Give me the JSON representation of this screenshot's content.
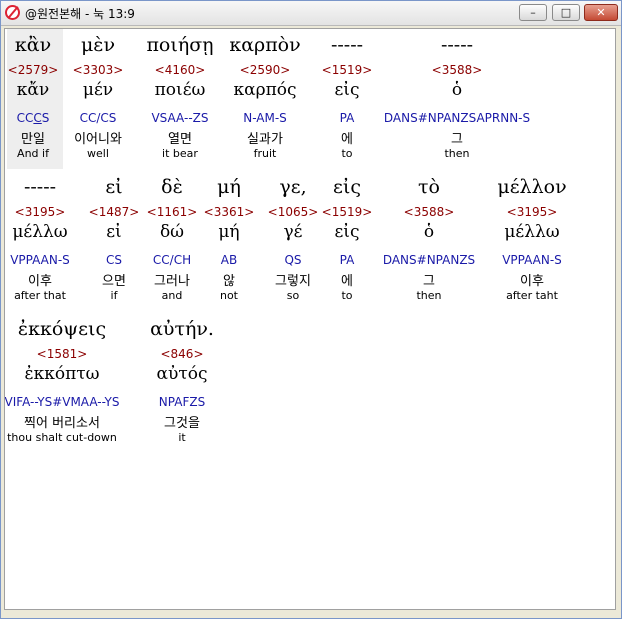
{
  "window": {
    "title": "@원전본해 - 눅 13:9",
    "minimize_label": "–",
    "maximize_label": "□",
    "close_label": "✕"
  },
  "lines": [
    {
      "words": [
        {
          "greek": "κἂν",
          "strong": "<2579>",
          "lemma": "κἄν",
          "parse": "CCCS",
          "korean": "만일",
          "english": "And if"
        },
        {
          "greek": "μὲν",
          "strong": "<3303>",
          "lemma": "μέν",
          "parse": "CC/CS",
          "korean": "이어니와",
          "english": "well"
        },
        {
          "greek": "ποιήσῃ",
          "strong": "<4160>",
          "lemma": "ποιέω",
          "parse": "VSAA--ZS",
          "korean": "열면",
          "english": "it bear"
        },
        {
          "greek": "καρπὸν",
          "strong": "<2590>",
          "lemma": "καρπός",
          "parse": "N-AM-S",
          "korean": "실과가",
          "english": "fruit"
        },
        {
          "greek": "-----",
          "strong": "<1519>",
          "lemma": "εἰς",
          "parse": "PA",
          "korean": "에",
          "english": "to"
        },
        {
          "greek": "-----",
          "strong": "<3588>",
          "lemma": "ὁ",
          "parse": "DANS#NPANZSAPRNN-S",
          "korean": "그",
          "english": "then"
        }
      ]
    },
    {
      "words": [
        {
          "greek": "-----",
          "strong": "<3195>",
          "lemma": "μέλλω",
          "parse": "VPPAAN-S",
          "korean": "이후",
          "english": "after that"
        },
        {
          "greek": "εἰ",
          "strong": "<1487>",
          "lemma": "εἰ",
          "parse": "CS",
          "korean": "으면",
          "english": "if"
        },
        {
          "greek": "δὲ",
          "strong": "<1161>",
          "lemma": "δώ",
          "parse": "CC/CH",
          "korean": "그러나",
          "english": "and"
        },
        {
          "greek": "μή",
          "strong": "<3361>",
          "lemma": "μή",
          "parse": "AB",
          "korean": "않",
          "english": "not"
        },
        {
          "greek": "γε,",
          "strong": "<1065>",
          "lemma": "γέ",
          "parse": "QS",
          "korean": "그렇지",
          "english": "so"
        },
        {
          "greek": "εἰς",
          "strong": "<1519>",
          "lemma": "εἰς",
          "parse": "PA",
          "korean": "에",
          "english": "to"
        },
        {
          "greek": "τὸ",
          "strong": "<3588>",
          "lemma": "ὁ",
          "parse": "DANS#NPANZS",
          "korean": "그",
          "english": "then"
        },
        {
          "greek": "μέλλον",
          "strong": "<3195>",
          "lemma": "μέλλω",
          "parse": "VPPAAN-S",
          "korean": "이후",
          "english": "after taht"
        }
      ]
    },
    {
      "words": [
        {
          "greek": "ἐκκόψεις",
          "strong": "<1581>",
          "lemma": "ἐκκόπτω",
          "parse": "VIFA--YS#VMAA--YS",
          "korean": "찍어 버리소서",
          "english": "thou shalt cut-down"
        },
        {
          "greek": "αὐτήν.",
          "strong": "<846>",
          "lemma": "αὐτός",
          "parse": "NPAFZS",
          "korean": "그것을",
          "english": "it"
        }
      ]
    }
  ]
}
